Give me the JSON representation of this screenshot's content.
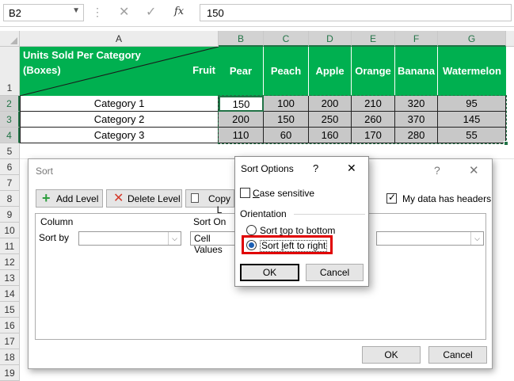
{
  "formula_bar": {
    "name_box": "B2",
    "fx": "fx",
    "value": "150"
  },
  "columns": [
    "A",
    "B",
    "C",
    "D",
    "E",
    "F",
    "G"
  ],
  "rows": [
    "1",
    "2",
    "3",
    "4",
    "5",
    "6",
    "7",
    "8",
    "9",
    "10",
    "11",
    "12",
    "13",
    "14",
    "15",
    "16",
    "17",
    "18",
    "19"
  ],
  "header_cell": {
    "line1": "Units Sold Per Category",
    "line2": "(Boxes)",
    "fruit": "Fruit"
  },
  "fruits": [
    "Pear",
    "Peach",
    "Apple",
    "Orange",
    "Banana",
    "Watermelon"
  ],
  "data_rows": [
    {
      "category": "Category 1",
      "values": [
        "150",
        "100",
        "200",
        "210",
        "320",
        "95"
      ]
    },
    {
      "category": "Category 2",
      "values": [
        "200",
        "150",
        "250",
        "260",
        "370",
        "145"
      ]
    },
    {
      "category": "Category 3",
      "values": [
        "110",
        "60",
        "160",
        "170",
        "280",
        "55"
      ]
    }
  ],
  "sort_dialog": {
    "title": "Sort",
    "help": "?",
    "close": "✕",
    "add_level": "Add Level",
    "delete_level": "Delete Level",
    "copy_level": "Copy L",
    "my_data_headers": "My data has headers",
    "col_column": "Column",
    "col_sort_on": "Sort On",
    "sort_by": "Sort by",
    "sort_on_value": "Cell Values",
    "ok": "OK",
    "cancel": "Cancel"
  },
  "sort_options": {
    "title": "Sort Options",
    "help": "?",
    "close": "✕",
    "case_sensitive": "Case sensitive",
    "orientation": "Orientation",
    "top_to_bottom": "Sort top to bottom",
    "left_to_right": "Sort left to right",
    "ok": "OK",
    "cancel": "Cancel"
  },
  "colors": {
    "green": "#00b050",
    "excel_green": "#217346",
    "highlight_red": "#e00000"
  }
}
